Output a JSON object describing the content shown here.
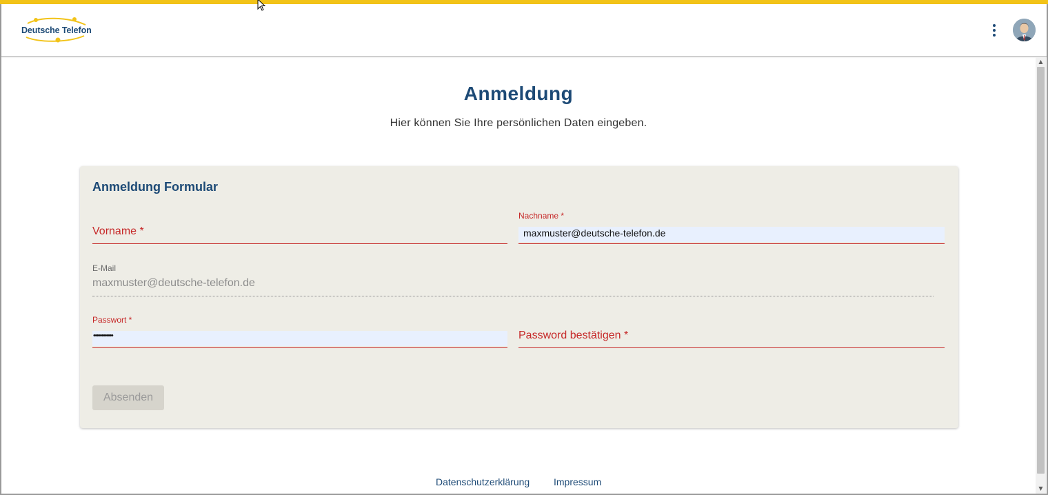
{
  "header": {
    "logo_text": "Deutsche Telefon",
    "accent_color": "#f2c318",
    "brand_color": "#1d4a76",
    "menu_icon": "more-vertical-icon",
    "avatar_icon": "user-avatar"
  },
  "page": {
    "title": "Anmeldung",
    "subtitle": "Hier können Sie Ihre persönlichen Daten eingeben."
  },
  "form": {
    "title": "Anmeldung Formular",
    "vorname": {
      "label": "Vorname *",
      "value": ""
    },
    "nachname": {
      "label": "Nachname *",
      "value": "maxmuster@deutsche-telefon.de"
    },
    "email": {
      "label": "E-Mail",
      "value": "maxmuster@deutsche-telefon.de"
    },
    "passwort": {
      "label": "Passwort *",
      "value": "••••••••••••"
    },
    "passwort_bestaetigen": {
      "label": "Password bestätigen *",
      "value": ""
    },
    "submit_label": "Absenden",
    "error_color": "#c62828"
  },
  "footer": {
    "links": [
      "Datenschutzerklärung",
      "Impressum"
    ]
  }
}
